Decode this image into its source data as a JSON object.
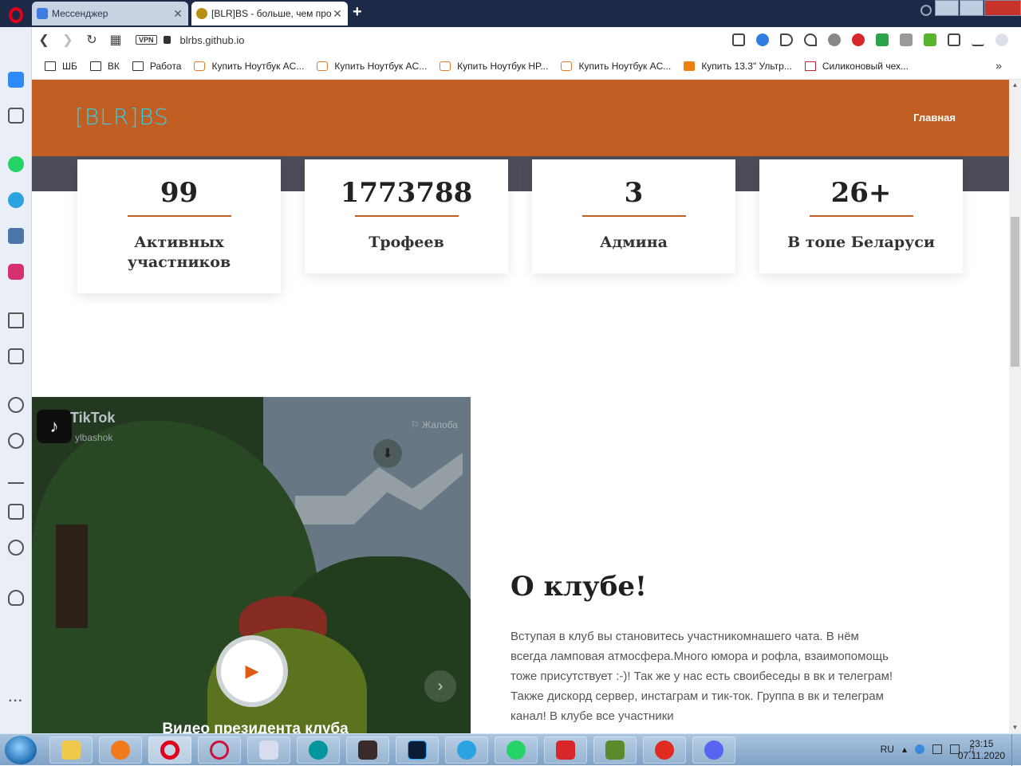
{
  "browser": {
    "tabs": [
      {
        "title": "Мессенджер",
        "active": false
      },
      {
        "title": "[BLR]BS - больше, чем про",
        "active": true
      }
    ],
    "new_tab_label": "+",
    "address": {
      "vpn_label": "VPN",
      "url": "blrbs.github.io"
    },
    "bookmarks": [
      {
        "label": "ШБ",
        "icon": "folder-icon"
      },
      {
        "label": "ВК",
        "icon": "folder-icon"
      },
      {
        "label": "Работа",
        "icon": "folder-icon"
      },
      {
        "label": "Купить Ноутбук AC...",
        "icon": "shop-icon"
      },
      {
        "label": "Купить Ноутбук AC...",
        "icon": "shop-icon"
      },
      {
        "label": "Купить Ноутбук HP...",
        "icon": "shop-icon"
      },
      {
        "label": "Купить Ноутбук AC...",
        "icon": "shop-icon"
      },
      {
        "label": "Купить 13.3\" Ультр...",
        "icon": "dns-icon"
      },
      {
        "label": "Силиконовый чех...",
        "icon": "heart-icon"
      }
    ],
    "more_bookmarks": "»"
  },
  "site": {
    "logo": "[BLR]BS",
    "nav": {
      "home": "Главная"
    },
    "colors": {
      "header": "#c05e23",
      "logo": "#2fd0e6",
      "band": "#4d4d5a"
    },
    "stats": [
      {
        "value": "99",
        "label": "Активных участников"
      },
      {
        "value": "1773788",
        "label": "Трофеев"
      },
      {
        "value": "3",
        "label": "Админа"
      },
      {
        "value": "26+",
        "label": "В топе Беларуси"
      }
    ],
    "video": {
      "brand": "TikTok",
      "user": "ylbashok",
      "report": "⚐ Жалоба",
      "caption": "Видео президента клуба"
    },
    "about": {
      "title": "О клубе!",
      "text": "Вступая в клуб вы становитесь участникомнашего чата. В нём всегда ламповая атмосфера.Много юмора и рофла, взаимопомощь тоже присутствует :-)! Так же у нас есть своибеседы в вк и телеграм! Также дискорд сервер, инстаграм и тик-ток. Группа в вк и телеграм канал! В клубе все участники"
    }
  },
  "taskbar": {
    "lang": "RU",
    "time": "23:15",
    "date": "07.11.2020"
  }
}
